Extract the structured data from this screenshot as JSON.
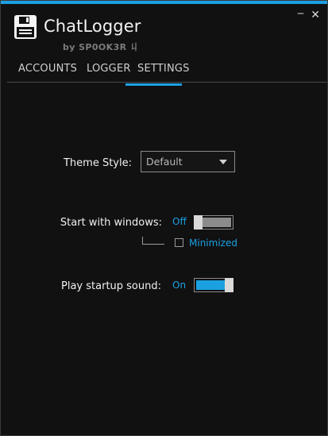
{
  "app": {
    "title": "ChatLogger",
    "byline": "by SP0OK3R 丩",
    "icon": "floppy-disk-icon"
  },
  "window_controls": {
    "minimize": "‒",
    "close": "✕"
  },
  "tabs": [
    {
      "label": "ACCOUNTS",
      "active": false
    },
    {
      "label": "LOGGER",
      "active": false
    },
    {
      "label": "SETTINGS",
      "active": true
    }
  ],
  "settings": {
    "theme_style": {
      "label": "Theme Style:",
      "value": "Default"
    },
    "start_with_windows": {
      "label": "Start with windows:",
      "state_text": "Off",
      "enabled": false
    },
    "minimized": {
      "label": "Minimized",
      "checked": false
    },
    "play_startup_sound": {
      "label": "Play startup sound:",
      "state_text": "On",
      "enabled": true
    }
  },
  "colors": {
    "accent": "#1ba1e2",
    "background": "#111112",
    "text": "#f0f0f0",
    "toggle_off_fill": "#8c8c8c",
    "toggle_thumb": "#d9d9d9"
  }
}
